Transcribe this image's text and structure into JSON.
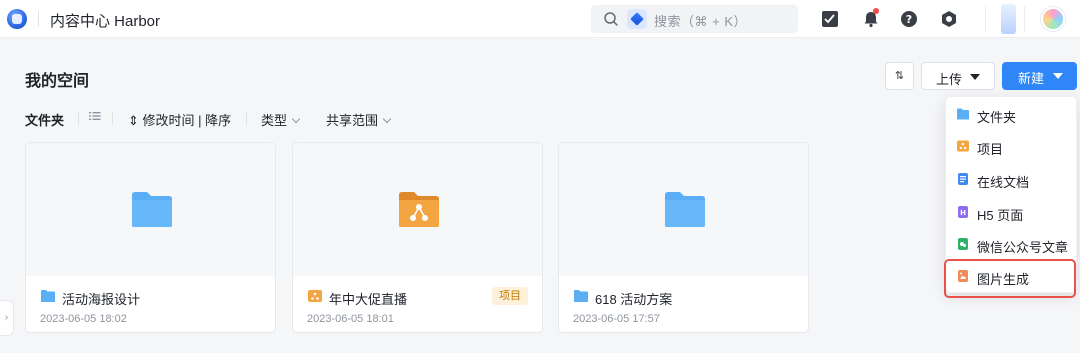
{
  "app": {
    "title": "内容中心 Harbor"
  },
  "search": {
    "placeholder": "搜索（⌘ + K）"
  },
  "header": {
    "title": "我的空间",
    "sort_label": "⇅",
    "upload_label": "上传",
    "new_label": "新建"
  },
  "filters": {
    "folder": "文件夹",
    "sort": "⇕ 修改时间 | 降序",
    "type": "类型",
    "share": "共享范围"
  },
  "cards": [
    {
      "name": "活动海报设计",
      "date": "2023-06-05 18:02",
      "kind": "folder",
      "tag": ""
    },
    {
      "name": "年中大促直播",
      "date": "2023-06-05 18:01",
      "kind": "project",
      "tag": "项目"
    },
    {
      "name": "618 活动方案",
      "date": "2023-06-05 17:57",
      "kind": "folder",
      "tag": ""
    }
  ],
  "menu": {
    "items": [
      {
        "label": "文件夹",
        "icon": "folder-icon"
      },
      {
        "label": "项目",
        "icon": "project-icon"
      },
      {
        "label": "在线文档",
        "icon": "doc-icon"
      },
      {
        "label": "H5 页面",
        "icon": "h5-icon"
      },
      {
        "label": "微信公众号文章",
        "icon": "wechat-article-icon"
      },
      {
        "label": "图片生成",
        "icon": "image-gen-icon"
      }
    ]
  },
  "colors": {
    "accent": "#2f86f6",
    "folder": "#5aaef5",
    "project": "#f2a540",
    "highlight": "#e8524a"
  },
  "side_toggle": "›"
}
